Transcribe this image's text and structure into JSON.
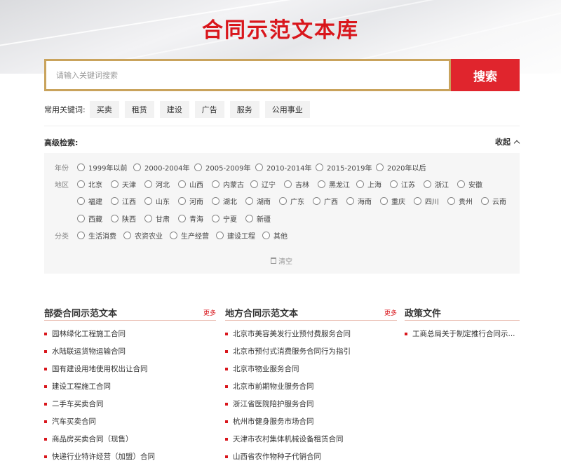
{
  "page": {
    "title": "合同示范文本库"
  },
  "search": {
    "placeholder": "请输入关键词搜索",
    "button_label": "搜索"
  },
  "keywords": {
    "label": "常用关键词:",
    "items": [
      "买卖",
      "租赁",
      "建设",
      "广告",
      "服务",
      "公用事业"
    ]
  },
  "advanced": {
    "title": "高级检索:",
    "collapse_label": "收起",
    "year": {
      "label": "年份",
      "options": [
        "1999年以前",
        "2000-2004年",
        "2005-2009年",
        "2010-2014年",
        "2015-2019年",
        "2020年以后"
      ]
    },
    "region": {
      "label": "地区",
      "options": [
        "北京",
        "天津",
        "河北",
        "山西",
        "内蒙古",
        "辽宁",
        "吉林",
        "黑龙江",
        "上海",
        "江苏",
        "浙江",
        "安徽",
        "福建",
        "江西",
        "山东",
        "河南",
        "湖北",
        "湖南",
        "广东",
        "广西",
        "海南",
        "重庆",
        "四川",
        "贵州",
        "云南",
        "西藏",
        "陕西",
        "甘肃",
        "青海",
        "宁夏",
        "新疆"
      ]
    },
    "category": {
      "label": "分类",
      "options": [
        "生活消费",
        "农资农业",
        "生产经营",
        "建设工程",
        "其他"
      ]
    },
    "clear_label": "清空"
  },
  "columns": [
    {
      "title": "部委合同示范文本",
      "more": "更多",
      "items": [
        "园林绿化工程施工合同",
        "水陆联运货物运输合同",
        "国有建设用地使用权出让合同",
        "建设工程施工合同",
        "二手车买卖合同",
        "汽车买卖合同",
        "商品房买卖合同（现售）",
        "快递行业特许经营（加盟）合同"
      ]
    },
    {
      "title": "地方合同示范文本",
      "more": "更多",
      "items": [
        "北京市美容美发行业预付费服务合同",
        "北京市预付式消费服务合同行为指引",
        "北京市物业服务合同",
        "北京市前期物业服务合同",
        "浙江省医院陪护服务合同",
        "杭州市健身服务市场合同",
        "天津市农村集体机械设备租赁合同",
        "山西省农作物种子代销合同"
      ]
    },
    {
      "title": "政策文件",
      "more": "",
      "items": [
        "工商总局关于制定推行合同示..."
      ]
    }
  ]
}
